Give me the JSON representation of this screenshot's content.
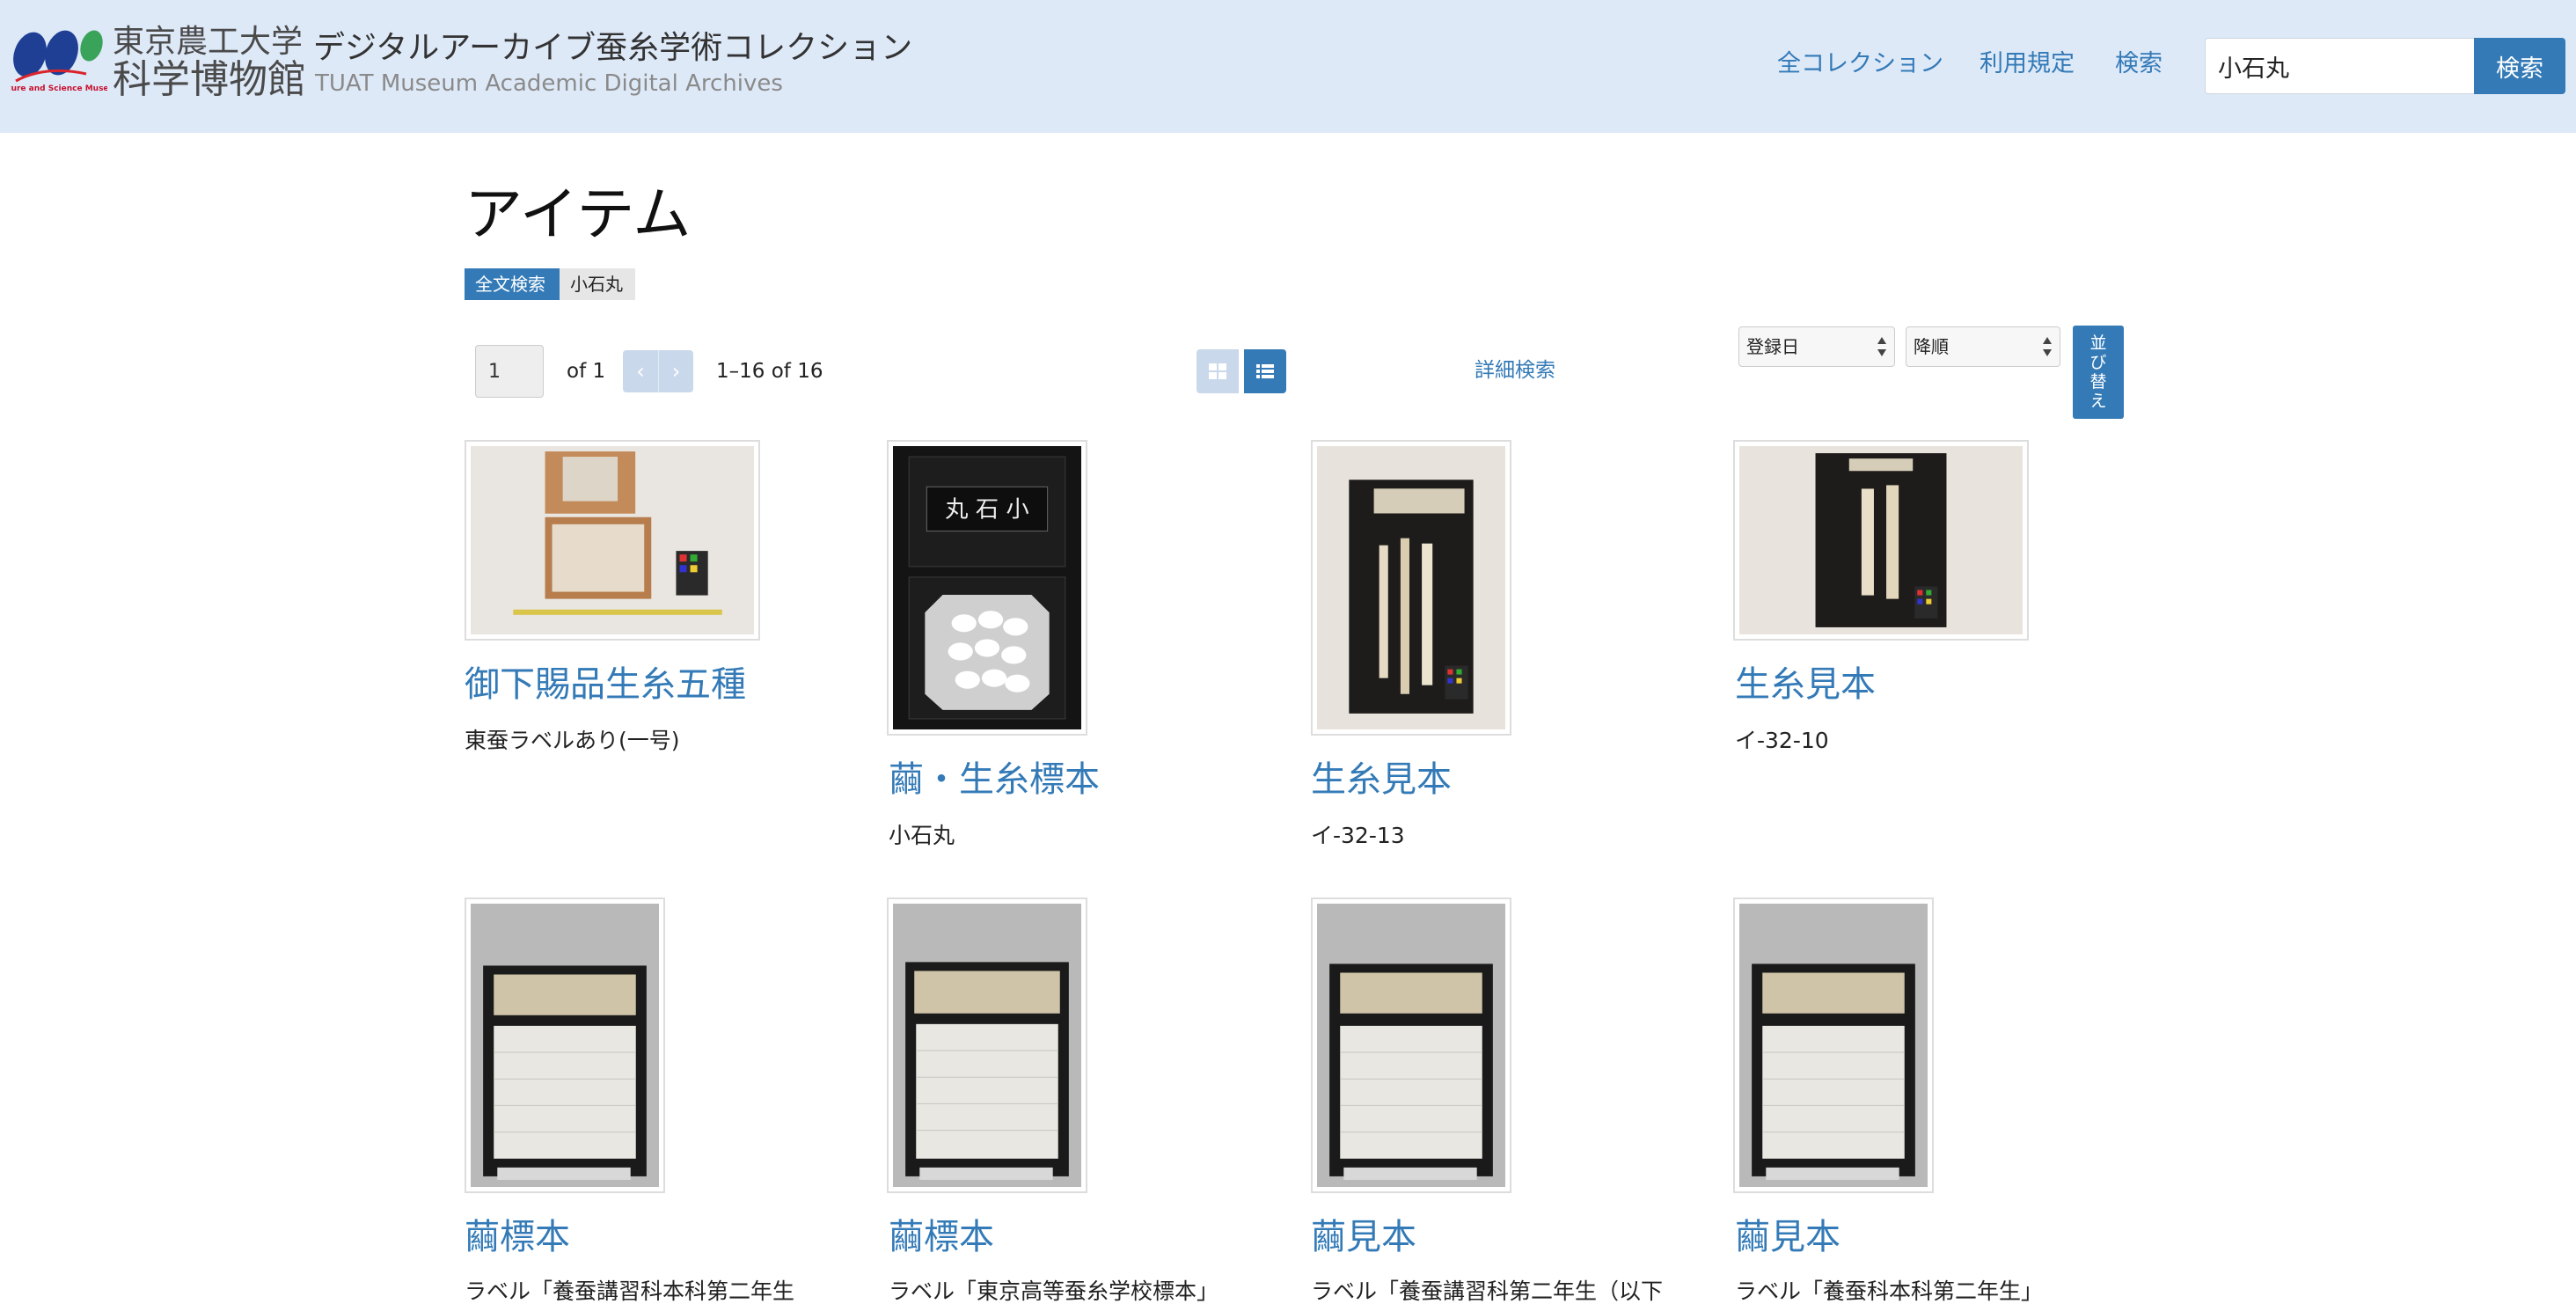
{
  "header": {
    "university": "東京農工大学",
    "museum": "科学博物館",
    "logo_caption": "Nature and Science Museum",
    "site_title": "デジタルアーカイブ蚕糸学術コレクション",
    "site_subtitle": "TUAT Museum Academic Digital Archives",
    "nav": [
      "全コレクション",
      "利用規定",
      "検索"
    ],
    "search_value": "小石丸",
    "search_button": "検索"
  },
  "page": {
    "title": "アイテム",
    "filter_key": "全文検索",
    "filter_value": "小石丸"
  },
  "pager": {
    "page_value": "1",
    "of_total": "of 1",
    "prev": "‹",
    "next": "›",
    "range": "1–16 of 16",
    "advanced_search": "詳細検索"
  },
  "sort": {
    "field": "登録日",
    "order": "降順",
    "button": "並び替え",
    "button_chars": [
      "並",
      "び",
      "替",
      "え"
    ]
  },
  "items": [
    {
      "title": "御下賜品生糸五種",
      "desc": "東蚕ラベルあり(一号)"
    },
    {
      "title": "繭・生糸標本",
      "desc": "小石丸"
    },
    {
      "title": "生糸見本",
      "desc": "イ-32-13"
    },
    {
      "title": "生糸見本",
      "desc": "イ-32-10"
    },
    {
      "title": "繭標本",
      "desc": "ラベル「養蚕講習科本科第二年生"
    },
    {
      "title": "繭標本",
      "desc": "ラベル「東京高等蚕糸学校標本」"
    },
    {
      "title": "繭見本",
      "desc": "ラベル「養蚕講習科第二年生（以下"
    },
    {
      "title": "繭見本",
      "desc": "ラベル「養蚕科本科第二年生」"
    }
  ],
  "colors": {
    "header_bg": "#dee9f8",
    "accent": "#337ab7",
    "link": "#337ab7"
  }
}
